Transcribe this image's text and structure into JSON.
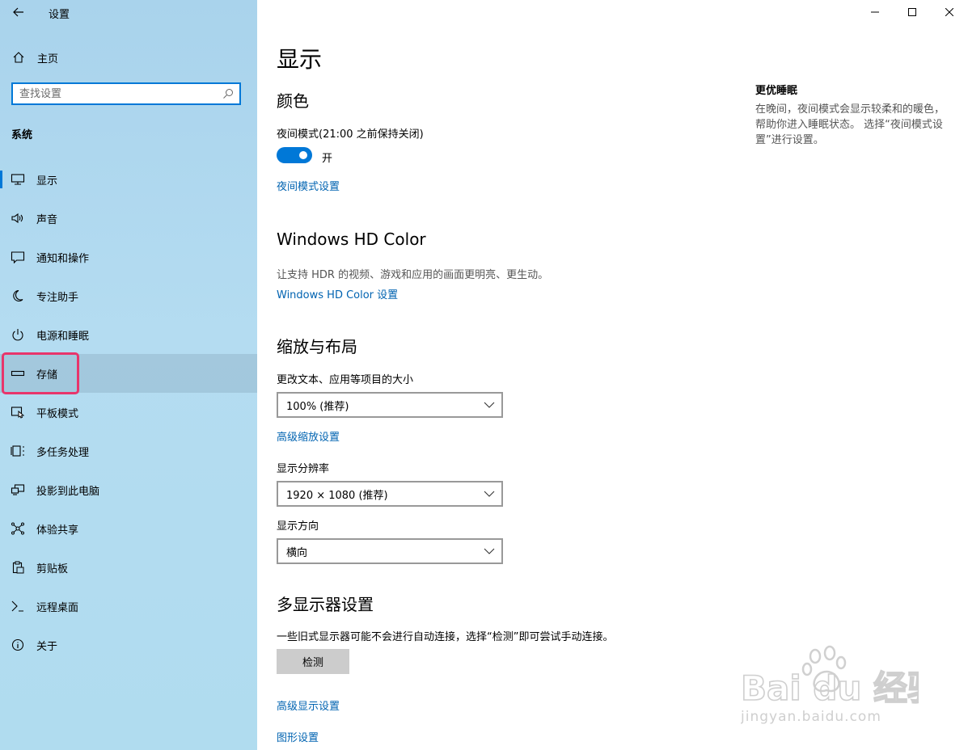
{
  "app": {
    "title": "设置"
  },
  "home": {
    "label": "主页"
  },
  "search": {
    "placeholder": "查找设置"
  },
  "sidebar": {
    "section": "系统",
    "items": [
      {
        "label": "显示",
        "icon": "monitor-icon"
      },
      {
        "label": "声音",
        "icon": "speaker-icon"
      },
      {
        "label": "通知和操作",
        "icon": "notification-icon"
      },
      {
        "label": "专注助手",
        "icon": "moon-icon"
      },
      {
        "label": "电源和睡眠",
        "icon": "power-icon"
      },
      {
        "label": "存储",
        "icon": "storage-icon"
      },
      {
        "label": "平板模式",
        "icon": "tablet-icon"
      },
      {
        "label": "多任务处理",
        "icon": "multitask-icon"
      },
      {
        "label": "投影到此电脑",
        "icon": "project-icon"
      },
      {
        "label": "体验共享",
        "icon": "share-icon"
      },
      {
        "label": "剪贴板",
        "icon": "clipboard-icon"
      },
      {
        "label": "远程桌面",
        "icon": "remote-icon"
      },
      {
        "label": "关于",
        "icon": "info-icon"
      }
    ],
    "active_index": 0,
    "highlighted_index": 5
  },
  "main": {
    "title": "显示",
    "color": {
      "heading": "颜色",
      "night_label": "夜间模式(21:00 之前保持关闭)",
      "toggle_state": "开",
      "night_settings_link": "夜间模式设置"
    },
    "hdr": {
      "heading": "Windows HD Color",
      "description": "让支持 HDR 的视频、游戏和应用的画面更明亮、更生动。",
      "link": "Windows HD Color 设置"
    },
    "scale": {
      "heading": "缩放与布局",
      "size_label": "更改文本、应用等项目的大小",
      "size_value": "100% (推荐)",
      "advanced_link": "高级缩放设置",
      "resolution_label": "显示分辨率",
      "resolution_value": "1920 × 1080 (推荐)",
      "orientation_label": "显示方向",
      "orientation_value": "横向"
    },
    "multi": {
      "heading": "多显示器设置",
      "description": "一些旧式显示器可能不会进行自动连接，选择“检测”即可尝试手动连接。",
      "detect_button": "检测",
      "advanced_display_link": "高级显示设置",
      "graphics_link": "图形设置"
    }
  },
  "aside": {
    "title": "更优睡眠",
    "text": "在晚间，夜间模式会显示较柔和的暖色，帮助你进入睡眠状态。 选择“夜间模式设置”进行设置。"
  },
  "watermark": {
    "brand": "Bai du 经验",
    "url": "jingyan.baidu.com"
  },
  "colors": {
    "accent": "#0078d7",
    "link": "#0063b1",
    "highlight": "#e8356b"
  }
}
